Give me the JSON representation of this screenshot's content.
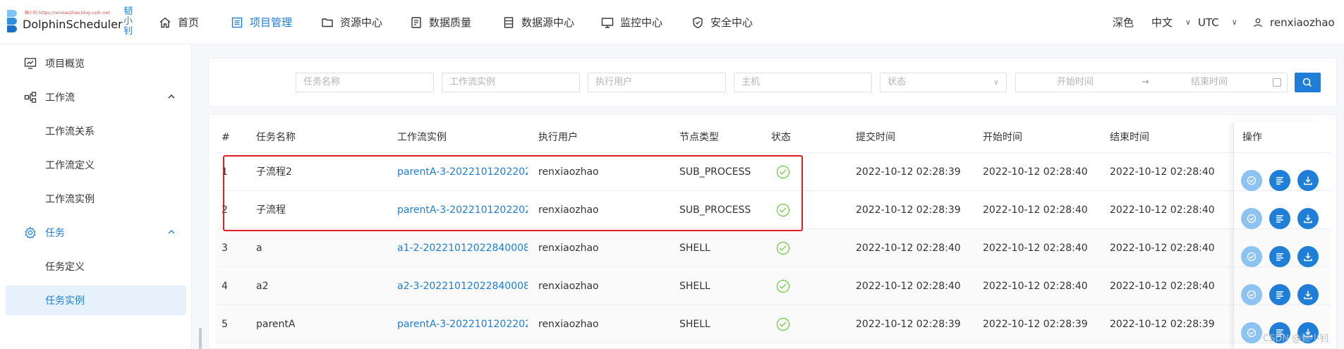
{
  "app": {
    "name": "DolphinScheduler",
    "watermark_small": "稿小钊 https://renxiaozhao.blog.csdn.net",
    "side_text": "韧小钊"
  },
  "nav": [
    {
      "label": "首页",
      "icon": "home-icon",
      "active": false
    },
    {
      "label": "项目管理",
      "icon": "project-icon",
      "active": true
    },
    {
      "label": "资源中心",
      "icon": "folder-icon",
      "active": false
    },
    {
      "label": "数据质量",
      "icon": "data-quality-icon",
      "active": false
    },
    {
      "label": "数据源中心",
      "icon": "datasource-icon",
      "active": false
    },
    {
      "label": "监控中心",
      "icon": "monitor-icon",
      "active": false
    },
    {
      "label": "安全中心",
      "icon": "shield-icon",
      "active": false
    }
  ],
  "header_right": {
    "theme": "深色",
    "language": "中文",
    "timezone": "UTC",
    "user": "renxiaozhao"
  },
  "sidebar": {
    "overview": "项目概览",
    "workflow_group": "工作流",
    "workflow_items": [
      "工作流关系",
      "工作流定义",
      "工作流实例"
    ],
    "task_group": "任务",
    "task_items": [
      "任务定义",
      "任务实例"
    ]
  },
  "search": {
    "task_name_placeholder": "任务名称",
    "workflow_instance_placeholder": "工作流实例",
    "executor_placeholder": "执行用户",
    "host_placeholder": "主机",
    "state_placeholder": "状态",
    "start_time_placeholder": "开始时间",
    "end_time_placeholder": "结束时间",
    "date_separator": "→"
  },
  "table": {
    "headers": {
      "index": "#",
      "task_name": "任务名称",
      "workflow_instance": "工作流实例",
      "executor": "执行用户",
      "node_type": "节点类型",
      "state": "状态",
      "submit_time": "提交时间",
      "start_time": "开始时间",
      "end_time": "结束时间",
      "actions": "操作"
    },
    "rows": [
      {
        "index": "1",
        "task_name": "子流程2",
        "workflow_instance": "parentA-3-2022101202202…",
        "executor": "renxiaozhao",
        "node_type": "SUB_PROCESS",
        "state": "success",
        "submit_time": "2022-10-12 02:28:39",
        "start_time": "2022-10-12 02:28:40",
        "end_time": "2022-10-12 02:28:40"
      },
      {
        "index": "2",
        "task_name": "子流程",
        "workflow_instance": "parentA-3-2022101202202…",
        "executor": "renxiaozhao",
        "node_type": "SUB_PROCESS",
        "state": "success",
        "submit_time": "2022-10-12 02:28:39",
        "start_time": "2022-10-12 02:28:40",
        "end_time": "2022-10-12 02:28:40"
      },
      {
        "index": "3",
        "task_name": "a",
        "workflow_instance": "a1-2-20221012022840008",
        "executor": "renxiaozhao",
        "node_type": "SHELL",
        "state": "success",
        "submit_time": "2022-10-12 02:28:40",
        "start_time": "2022-10-12 02:28:40",
        "end_time": "2022-10-12 02:28:40"
      },
      {
        "index": "4",
        "task_name": "a2",
        "workflow_instance": "a2-3-20221012022840008",
        "executor": "renxiaozhao",
        "node_type": "SHELL",
        "state": "success",
        "submit_time": "2022-10-12 02:28:40",
        "start_time": "2022-10-12 02:28:40",
        "end_time": "2022-10-12 02:28:40"
      },
      {
        "index": "5",
        "task_name": "parentA",
        "workflow_instance": "parentA-3-2022101202202…",
        "executor": "renxiaozhao",
        "node_type": "SHELL",
        "state": "success",
        "submit_time": "2022-10-12 02:28:39",
        "start_time": "2022-10-12 02:28:39",
        "end_time": "2022-10-12 02:28:39"
      }
    ]
  },
  "watermark": "CSDN @韧小钊",
  "colors": {
    "primary": "#1e7ed8",
    "success": "#52c41a",
    "highlight": "#e02020"
  }
}
